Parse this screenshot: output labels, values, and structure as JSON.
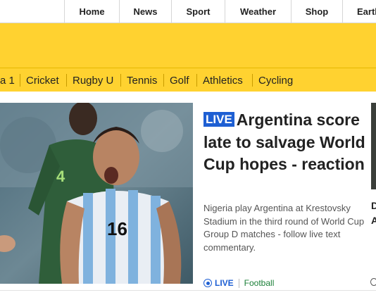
{
  "top_nav": {
    "items": [
      "Home",
      "News",
      "Sport",
      "Weather",
      "Shop",
      "Earth"
    ]
  },
  "sport_nav": {
    "items": [
      "a 1",
      "Cricket",
      "Rugby U",
      "Tennis",
      "Golf",
      "Athletics",
      "Cycling"
    ]
  },
  "article": {
    "live_badge": "LIVE",
    "headline": "Argentina score late to salvage World Cup hopes - reaction",
    "summary": "Nigeria play Argentina at Krestovsky Stadium in the third round of World Cup Group D matches - follow live text commentary.",
    "meta_live": "LIVE",
    "meta_topic": "Football",
    "image_shirt_number": "16"
  },
  "side_card": {
    "text_lines": [
      "D",
      "A"
    ]
  },
  "colors": {
    "sport_yellow": "#ffd230",
    "live_blue": "#1e5fd3",
    "topic_green": "#1a7f37"
  }
}
